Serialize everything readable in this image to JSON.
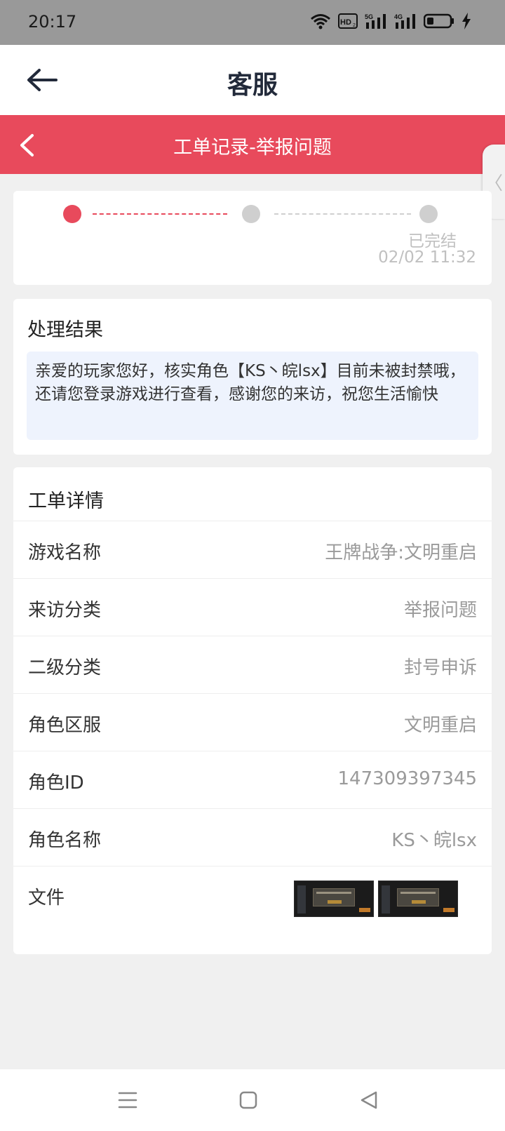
{
  "status_bar": {
    "time": "20:17",
    "icons": [
      "wifi-icon",
      "hd-icon",
      "signal-5g-icon",
      "signal-4g-icon",
      "battery-icon",
      "charging-icon"
    ],
    "hd_label": "HD",
    "hd_sub": "2",
    "sig1_label": "5G",
    "sig2_label": "4G"
  },
  "header": {
    "title": "客服",
    "back_icon": "arrow-left-icon"
  },
  "subheader": {
    "title": "工单记录-举报问题",
    "back_icon": "chevron-left-icon",
    "accent": "#e84a5c"
  },
  "side_tab": {
    "icon": "chevron-left-icon",
    "glyph": "〈"
  },
  "progress": {
    "steps": 3,
    "current_step": 1,
    "status": "已完结",
    "time": "02/02 11:32"
  },
  "result": {
    "title": "处理结果",
    "message": "亲爱的玩家您好，核实角色【KS丶皖lsx】目前未被封禁哦，还请您登录游戏进行查看，感谢您的来访，祝您生活愉快"
  },
  "details": {
    "title": "工单详情",
    "rows": [
      {
        "label": "游戏名称",
        "value": "王牌战争:文明重启"
      },
      {
        "label": "来访分类",
        "value": "举报问题"
      },
      {
        "label": "二级分类",
        "value": "封号申诉"
      },
      {
        "label": "角色区服",
        "value": "文明重启"
      },
      {
        "label": "角色ID",
        "value": "147309397345"
      },
      {
        "label": "角色名称",
        "value": "KS丶皖lsx"
      }
    ],
    "file_label": "文件",
    "file_count": 2
  },
  "nav": {
    "buttons": [
      "menu-icon",
      "home-icon",
      "back-triangle-icon"
    ]
  }
}
